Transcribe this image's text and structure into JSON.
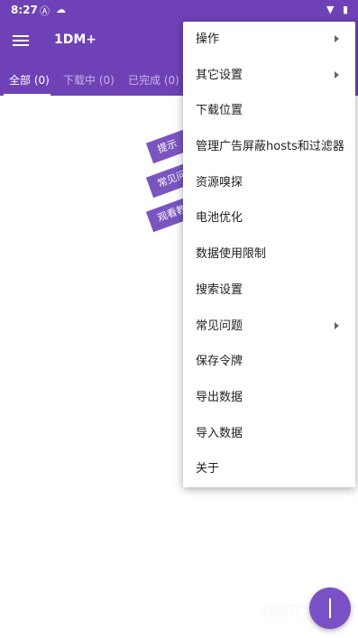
{
  "status": {
    "time": "8:27",
    "icons": [
      "a-icon",
      "cloud-icon",
      "wifi-icon",
      "battery-icon"
    ]
  },
  "appbar": {
    "title": "1DM+"
  },
  "tabs": [
    {
      "label": "全部 (0)"
    },
    {
      "label": "下载中 (0)"
    },
    {
      "label": "已完成 (0)"
    }
  ],
  "tips": [
    {
      "label": "提示"
    },
    {
      "label": "常见问"
    },
    {
      "label": "观看教"
    }
  ],
  "menu": {
    "items": [
      {
        "label": "操作",
        "submenu": true
      },
      {
        "label": "其它设置",
        "submenu": true
      },
      {
        "label": "下载位置",
        "submenu": false
      },
      {
        "label": "管理广告屏蔽hosts和过滤器",
        "submenu": false
      },
      {
        "label": "资源嗅探",
        "submenu": false
      },
      {
        "label": "电池优化",
        "submenu": false
      },
      {
        "label": "数据使用限制",
        "submenu": false
      },
      {
        "label": "搜索设置",
        "submenu": false
      },
      {
        "label": "常见问题",
        "submenu": true
      },
      {
        "label": "保存令牌",
        "submenu": false
      },
      {
        "label": "导出数据",
        "submenu": false
      },
      {
        "label": "导入数据",
        "submenu": false
      },
      {
        "label": "关于",
        "submenu": false
      }
    ]
  },
  "watermark": {
    "text": "com"
  },
  "colors": {
    "primary": "#6f41b6",
    "tip": "#7a55c0",
    "fab": "#7a50c6"
  }
}
